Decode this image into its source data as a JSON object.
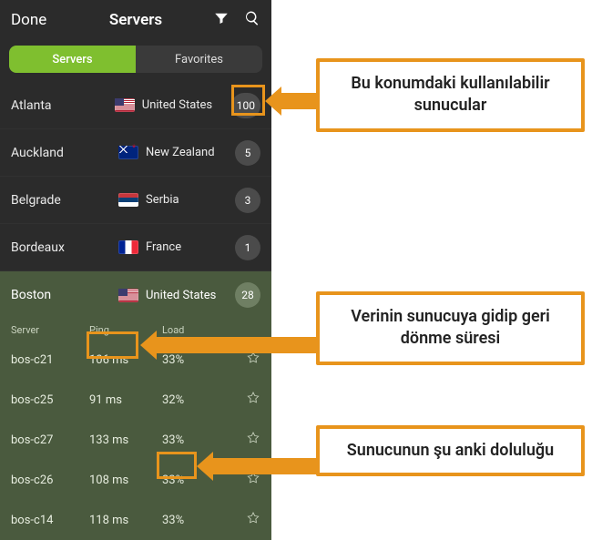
{
  "header": {
    "done": "Done",
    "title": "Servers"
  },
  "tabs": {
    "servers": "Servers",
    "favorites": "Favorites"
  },
  "locations": [
    {
      "city": "Atlanta",
      "country": "United States",
      "flag": "us",
      "count": "100"
    },
    {
      "city": "Auckland",
      "country": "New Zealand",
      "flag": "nz",
      "count": "5"
    },
    {
      "city": "Belgrade",
      "country": "Serbia",
      "flag": "rs",
      "count": "3"
    },
    {
      "city": "Bordeaux",
      "country": "France",
      "flag": "fr",
      "count": "1"
    }
  ],
  "expanded": {
    "city": "Boston",
    "country": "United States",
    "flag": "us",
    "count": "28",
    "columns": {
      "server": "Server",
      "ping": "Ping",
      "load": "Load"
    },
    "servers": [
      {
        "name": "bos-c21",
        "ping": "106 ms",
        "load": "33%"
      },
      {
        "name": "bos-c25",
        "ping": "91 ms",
        "load": "32%"
      },
      {
        "name": "bos-c27",
        "ping": "133 ms",
        "load": "33%"
      },
      {
        "name": "bos-c26",
        "ping": "108 ms",
        "load": "33%"
      },
      {
        "name": "bos-c14",
        "ping": "118 ms",
        "load": "33%"
      }
    ]
  },
  "annotations": {
    "count": "Bu konumdaki kullanılabilir sunucular",
    "ping": "Verinin sunucuya gidip geri dönme süresi",
    "load": "Sunucunun şu anki doluluğu"
  }
}
